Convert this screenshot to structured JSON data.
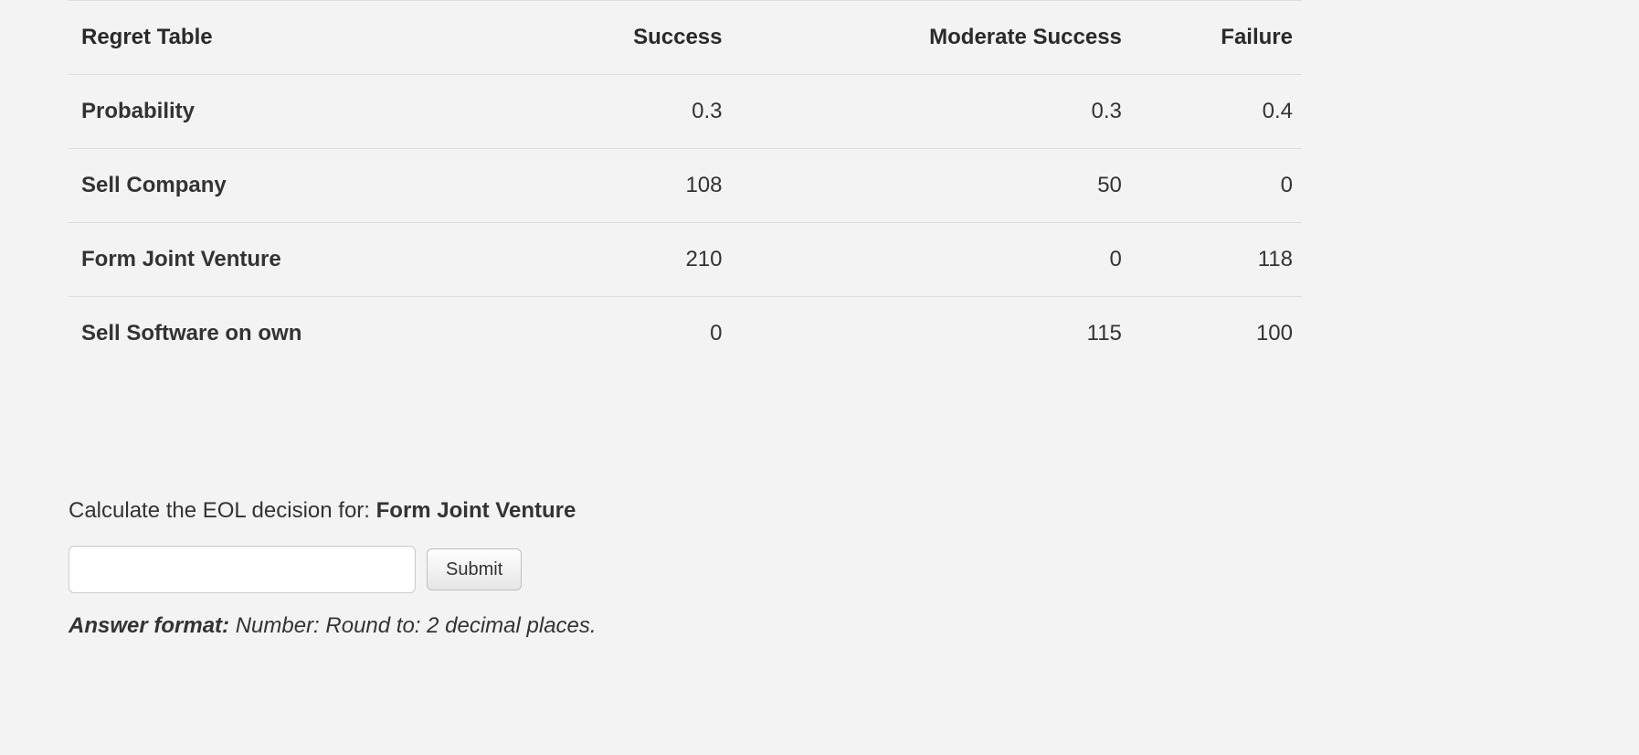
{
  "table": {
    "headers": [
      "Regret Table",
      "Success",
      "Moderate Success",
      "Failure"
    ],
    "rows": [
      {
        "label": "Probability",
        "values": [
          "0.3",
          "0.3",
          "0.4"
        ]
      },
      {
        "label": "Sell Company",
        "values": [
          "108",
          "50",
          "0"
        ]
      },
      {
        "label": "Form Joint Venture",
        "values": [
          "210",
          "0",
          "118"
        ]
      },
      {
        "label": "Sell Software on own",
        "values": [
          "0",
          "115",
          "100"
        ]
      }
    ]
  },
  "question": {
    "prefix": "Calculate the EOL decision for: ",
    "target": "Form Joint Venture"
  },
  "submit_label": "Submit",
  "answer_format": {
    "label": "Answer format:",
    "text": " Number: Round to: 2 decimal places."
  }
}
